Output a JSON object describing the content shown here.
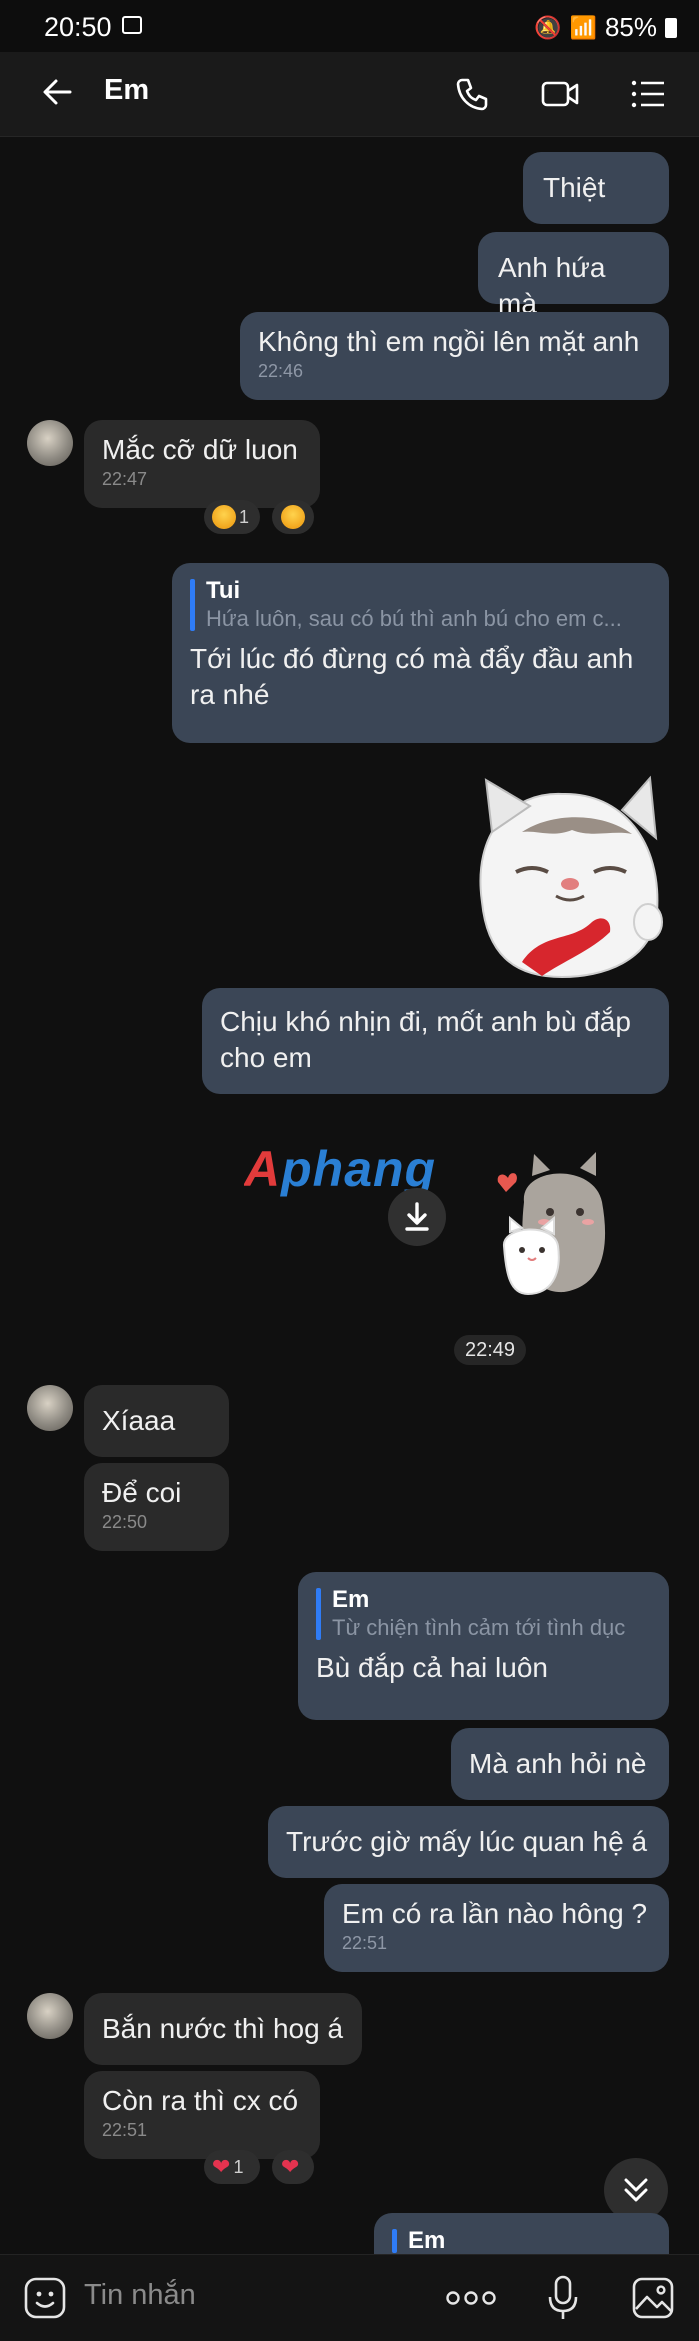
{
  "status": {
    "time": "20:50",
    "battery": "85%"
  },
  "header": {
    "title": "Em"
  },
  "messages": {
    "m1": {
      "text": "Thiệt"
    },
    "m2": {
      "text": "Anh hứa mà"
    },
    "m3": {
      "text": "Không thì em ngồi lên mặt anh",
      "time": "22:46"
    },
    "m4": {
      "text": "Mắc cỡ dữ luon",
      "time": "22:47",
      "reaction_count": "1"
    },
    "m5": {
      "reply_name": "Tui",
      "reply_text": "Hứa luôn, sau có bú thì anh bú cho em c...",
      "text_line1": "Tới lúc đó đừng có mà đẩy đầu anh",
      "text_line2": "ra nhé"
    },
    "m6": {
      "text_line1": "Chịu khó nhịn đi, mốt anh bù đắp",
      "text_line2": "cho em"
    },
    "sticker_brand": "Aphang",
    "time_divider": "22:49",
    "m7": {
      "text": "Xíaaa"
    },
    "m8": {
      "text": "Để coi",
      "time": "22:50"
    },
    "m9": {
      "reply_name": "Em",
      "reply_text": "Từ chiện tình cảm tới tình dục",
      "text": "Bù đắp cả hai luôn"
    },
    "m10": {
      "text": "Mà anh hỏi nè"
    },
    "m11": {
      "text": "Trước giờ mấy lúc quan hệ á"
    },
    "m12": {
      "text": "Em có ra lần nào hông ?",
      "time": "22:51"
    },
    "m13": {
      "text": "Bắn nước thì hog á"
    },
    "m14": {
      "text": "Còn ra thì cx có",
      "time": "22:51",
      "reaction_count": "1"
    },
    "m15": {
      "reply_name": "Em"
    }
  },
  "composer": {
    "placeholder": "Tin nhắn"
  },
  "colors": {
    "outgoing": "#3b4656",
    "incoming": "#2a2a2a",
    "accent": "#2f7cf6"
  }
}
